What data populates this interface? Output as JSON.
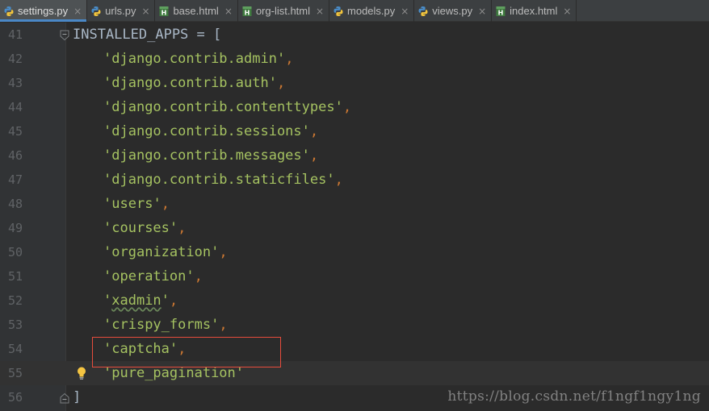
{
  "tabs": [
    {
      "label": "settings.py",
      "icon": "python-file-icon",
      "active": true
    },
    {
      "label": "urls.py",
      "icon": "python-file-icon",
      "active": false
    },
    {
      "label": "base.html",
      "icon": "html-file-icon",
      "active": false
    },
    {
      "label": "org-list.html",
      "icon": "html-file-icon",
      "active": false
    },
    {
      "label": "models.py",
      "icon": "python-file-icon",
      "active": false
    },
    {
      "label": "views.py",
      "icon": "python-file-icon",
      "active": false
    },
    {
      "label": "index.html",
      "icon": "html-file-icon",
      "active": false
    }
  ],
  "tab_close_glyph": "×",
  "editor": {
    "lines": [
      {
        "number": "41",
        "head": "INSTALLED_APPS = ["
      },
      {
        "number": "42",
        "value": "django.contrib.admin",
        "comma": ","
      },
      {
        "number": "43",
        "value": "django.contrib.auth",
        "comma": ","
      },
      {
        "number": "44",
        "value": "django.contrib.contenttypes",
        "comma": ","
      },
      {
        "number": "45",
        "value": "django.contrib.sessions",
        "comma": ","
      },
      {
        "number": "46",
        "value": "django.contrib.messages",
        "comma": ","
      },
      {
        "number": "47",
        "value": "django.contrib.staticfiles",
        "comma": ","
      },
      {
        "number": "48",
        "value": "users",
        "comma": ","
      },
      {
        "number": "49",
        "value": "courses",
        "comma": ","
      },
      {
        "number": "50",
        "value": "organization",
        "comma": ","
      },
      {
        "number": "51",
        "value": "operation",
        "comma": ","
      },
      {
        "number": "52",
        "value": "xadmin",
        "comma": ",",
        "typo": true
      },
      {
        "number": "53",
        "value": "crispy_forms",
        "comma": ","
      },
      {
        "number": "54",
        "value": "captcha",
        "comma": ","
      },
      {
        "number": "55",
        "value": "pure_pagination",
        "comma": "",
        "current": true,
        "bulb": true
      },
      {
        "number": "56",
        "head": "]"
      }
    ],
    "quote": "'"
  },
  "watermark": "https://blog.csdn.net/f1ngf1ngy1ng",
  "colors": {
    "background": "#2b2b2b",
    "gutter": "#313335",
    "string": "#a5c261",
    "punctuation": "#cc7832",
    "text": "#a9b7c6",
    "line_number": "#606366",
    "highlight_box": "#e74c3c",
    "active_tab_accent": "#4a88c7"
  }
}
